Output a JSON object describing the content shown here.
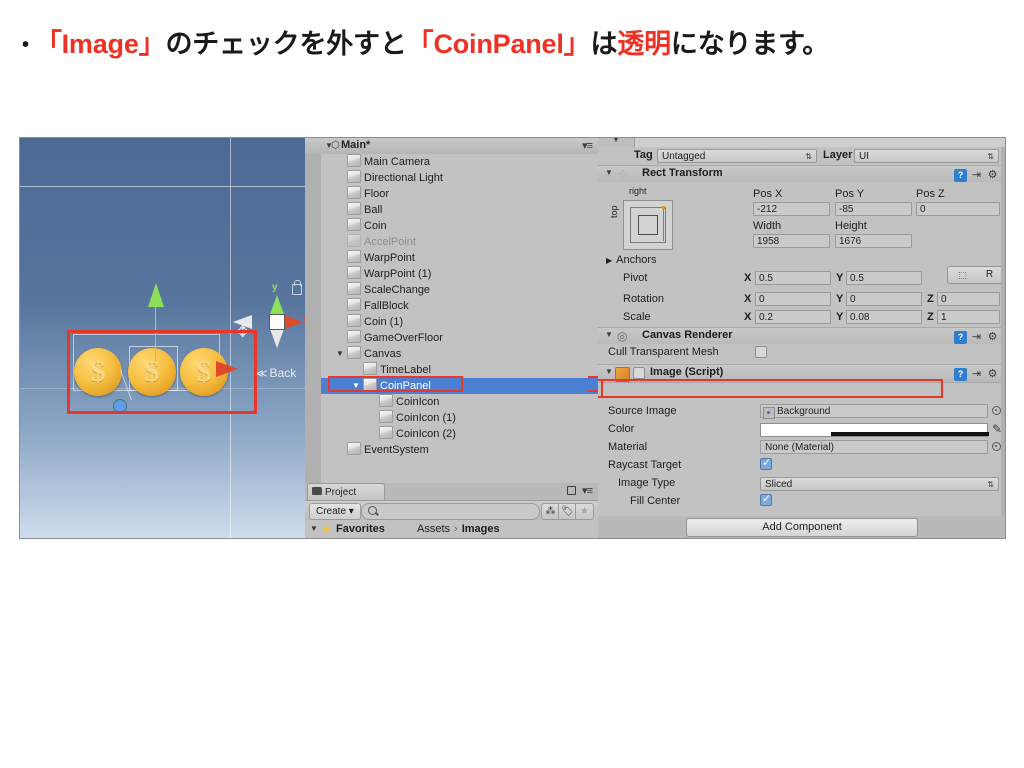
{
  "slide": {
    "bullet_marker": "•",
    "text_parts": [
      {
        "t": "「Image」",
        "color": "red"
      },
      {
        "t": "のチェックを外すと",
        "color": "black"
      },
      {
        "t": "「CoinPanel」",
        "color": "red"
      },
      {
        "t": "は",
        "color": "black"
      },
      {
        "t": "透明",
        "color": "red"
      },
      {
        "t": "になります。",
        "color": "black"
      }
    ],
    "accent_color": "#ee3124"
  },
  "scene_view": {
    "back_label": "Back",
    "gizmo_axis_y": "y",
    "gizmo_axis_x": "x",
    "coins": [
      "$",
      "$",
      "$"
    ],
    "highlight_color": "#e8372a"
  },
  "hierarchy": {
    "scene_name": "Main*",
    "items": [
      {
        "label": "Main Camera",
        "indent": 1,
        "arrow": "",
        "dim": false,
        "selected": false
      },
      {
        "label": "Directional Light",
        "indent": 1,
        "arrow": "",
        "dim": false,
        "selected": false
      },
      {
        "label": "Floor",
        "indent": 1,
        "arrow": "",
        "dim": false,
        "selected": false
      },
      {
        "label": "Ball",
        "indent": 1,
        "arrow": "",
        "dim": false,
        "selected": false
      },
      {
        "label": "Coin",
        "indent": 1,
        "arrow": "",
        "dim": false,
        "selected": false
      },
      {
        "label": "AccelPoint",
        "indent": 1,
        "arrow": "",
        "dim": true,
        "selected": false
      },
      {
        "label": "WarpPoint",
        "indent": 1,
        "arrow": "",
        "dim": false,
        "selected": false
      },
      {
        "label": "WarpPoint (1)",
        "indent": 1,
        "arrow": "",
        "dim": false,
        "selected": false
      },
      {
        "label": "ScaleChange",
        "indent": 1,
        "arrow": "",
        "dim": false,
        "selected": false
      },
      {
        "label": "FallBlock",
        "indent": 1,
        "arrow": "",
        "dim": false,
        "selected": false
      },
      {
        "label": "Coin (1)",
        "indent": 1,
        "arrow": "",
        "dim": false,
        "selected": false
      },
      {
        "label": "GameOverFloor",
        "indent": 1,
        "arrow": "",
        "dim": false,
        "selected": false
      },
      {
        "label": "Canvas",
        "indent": 1,
        "arrow": "▼",
        "dim": false,
        "selected": false
      },
      {
        "label": "TimeLabel",
        "indent": 2,
        "arrow": "",
        "dim": false,
        "selected": false
      },
      {
        "label": "CoinPanel",
        "indent": 2,
        "arrow": "▼",
        "dim": false,
        "selected": true
      },
      {
        "label": "CoinIcon",
        "indent": 3,
        "arrow": "",
        "dim": false,
        "selected": false
      },
      {
        "label": "CoinIcon (1)",
        "indent": 3,
        "arrow": "",
        "dim": false,
        "selected": false
      },
      {
        "label": "CoinIcon (2)",
        "indent": 3,
        "arrow": "",
        "dim": false,
        "selected": false
      },
      {
        "label": "EventSystem",
        "indent": 1,
        "arrow": "",
        "dim": false,
        "selected": false
      }
    ],
    "selected_color": "#4a7fd4"
  },
  "project": {
    "tab_label": "Project",
    "create_label": "Create",
    "create_arrow": "▾",
    "search_placeholder": "",
    "search_value": "",
    "favorites_label": "Favorites",
    "breadcrumb_root": "Assets",
    "breadcrumb_sep": "›",
    "breadcrumb_current": "Images"
  },
  "inspector": {
    "tag_label": "Tag",
    "tag_value": "Untagged",
    "layer_label": "Layer",
    "layer_value": "UI",
    "rect_transform": {
      "title": "Rect Transform",
      "anchor_right_label": "right",
      "anchor_top_label": "top",
      "pos_x_label": "Pos X",
      "pos_y_label": "Pos Y",
      "pos_z_label": "Pos Z",
      "pos_x": "-212",
      "pos_y": "-85",
      "pos_z": "0",
      "width_label": "Width",
      "height_label": "Height",
      "width": "1958",
      "height": "1676",
      "blueprint_btn": "⬚",
      "raw_btn": "R",
      "anchors_label": "Anchors",
      "anchors_arrow": "▶",
      "pivot_label": "Pivot",
      "pivot_x": "0.5",
      "pivot_y": "0.5",
      "rotation_label": "Rotation",
      "rotation_x": "0",
      "rotation_y": "0",
      "rotation_z": "0",
      "scale_label": "Scale",
      "scale_x": "0.2",
      "scale_y": "0.08",
      "scale_z": "1",
      "axis_x": "X",
      "axis_y": "Y",
      "axis_z": "Z"
    },
    "canvas_renderer": {
      "title": "Canvas Renderer",
      "cull_label": "Cull Transparent Mesh",
      "cull_checked": false
    },
    "image_script": {
      "title": "Image (Script)",
      "enabled_checked": false,
      "source_image_label": "Source Image",
      "source_image_value": "Background",
      "color_label": "Color",
      "color_value": "#FFFFFF",
      "material_label": "Material",
      "material_value": "None (Material)",
      "raycast_label": "Raycast Target",
      "raycast_checked": true,
      "image_type_label": "Image Type",
      "image_type_value": "Sliced",
      "fill_center_label": "Fill Center",
      "fill_center_checked": true,
      "highlight_color": "#e8372a"
    },
    "add_component_label": "Add Component",
    "help_icon": "?",
    "preset_icon": "⇥",
    "gear_icon": "⚙"
  }
}
